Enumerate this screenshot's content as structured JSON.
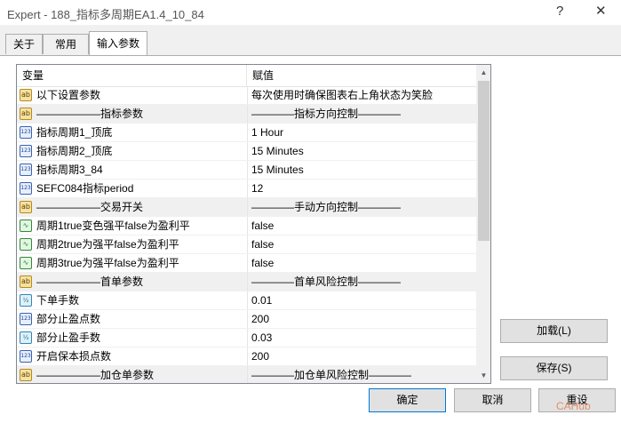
{
  "window": {
    "title": "Expert - 188_指标多周期EA1.4_10_84",
    "help": "?",
    "close": "✕"
  },
  "tabs": [
    {
      "label": "关于"
    },
    {
      "label": "常用"
    },
    {
      "label": "输入参数"
    }
  ],
  "grid": {
    "headers": {
      "variable": "变量",
      "value": "赋值"
    },
    "rows": [
      {
        "icon": "ab",
        "name": "以下设置参数",
        "value": "每次使用时确保图表右上角状态为笑脸"
      },
      {
        "icon": "ab",
        "name": "——————指标参数",
        "value": "————指标方向控制————"
      },
      {
        "icon": "123",
        "name": "指标周期1_顶底",
        "value": "1 Hour"
      },
      {
        "icon": "123",
        "name": "指标周期2_顶底",
        "value": "15 Minutes"
      },
      {
        "icon": "123",
        "name": "指标周期3_84",
        "value": "15 Minutes"
      },
      {
        "icon": "123",
        "name": "SEFC084指标period",
        "value": "12"
      },
      {
        "icon": "ab",
        "name": "——————交易开关",
        "value": "————手动方向控制————"
      },
      {
        "icon": "bool",
        "name": "周期1true变色强平false为盈利平",
        "value": "false"
      },
      {
        "icon": "bool",
        "name": "周期2true为强平false为盈利平",
        "value": "false"
      },
      {
        "icon": "bool",
        "name": "周期3true为强平false为盈利平",
        "value": "false"
      },
      {
        "icon": "ab",
        "name": "——————首单参数",
        "value": "————首单风险控制————"
      },
      {
        "icon": "v2",
        "name": "下单手数",
        "value": "0.01"
      },
      {
        "icon": "123",
        "name": "部分止盈点数",
        "value": "200"
      },
      {
        "icon": "v2",
        "name": "部分止盈手数",
        "value": "0.03"
      },
      {
        "icon": "123",
        "name": "开启保本损点数",
        "value": "200"
      },
      {
        "icon": "ab",
        "name": "——————加仓单参数",
        "value": "————加仓单风险控制————"
      }
    ]
  },
  "icons": {
    "ab": "ab",
    "123": "123",
    "bool": "∿",
    "v2": "½"
  },
  "buttons": {
    "load": "加载(L)",
    "save": "保存(S)",
    "ok": "确定",
    "cancel": "取消",
    "reset": "重设"
  },
  "watermark": "CAHub"
}
